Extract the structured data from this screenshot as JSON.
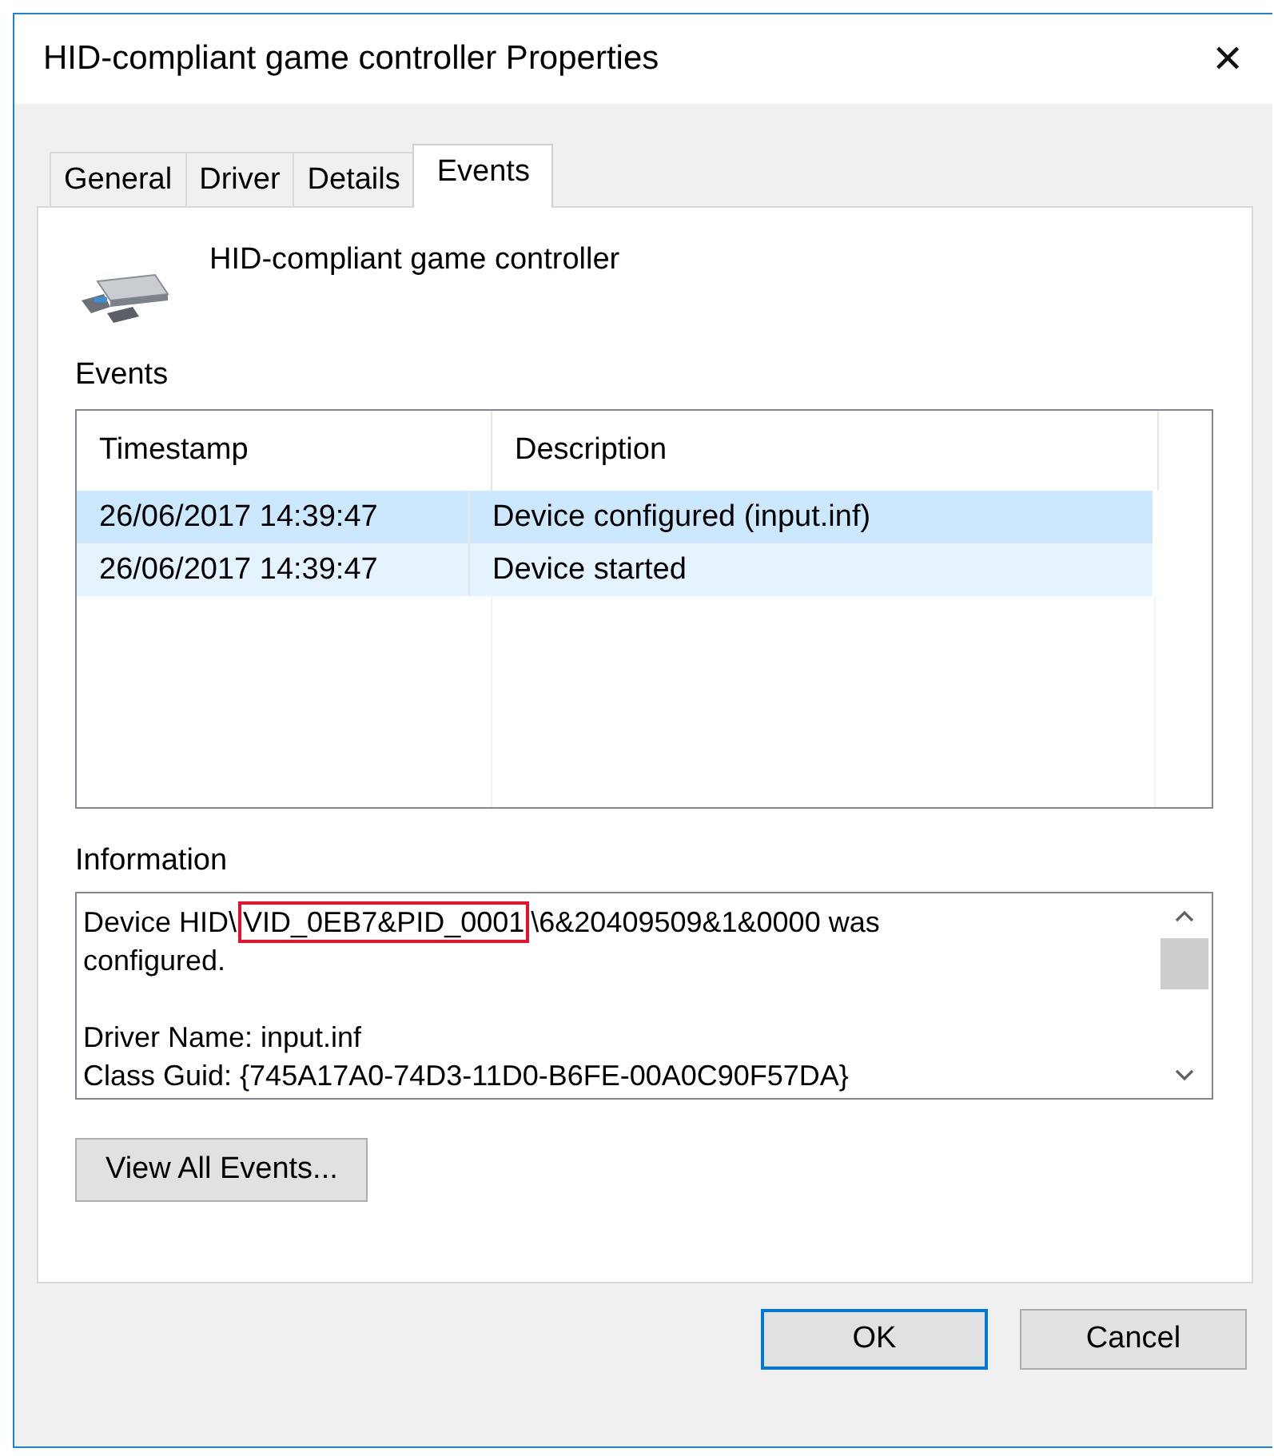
{
  "window": {
    "title": "HID-compliant game controller Properties",
    "close": "✕"
  },
  "tabs": [
    {
      "label": "General",
      "selected": false
    },
    {
      "label": "Driver",
      "selected": false
    },
    {
      "label": "Details",
      "selected": false
    },
    {
      "label": "Events",
      "selected": true
    }
  ],
  "device": {
    "name": "HID-compliant game controller"
  },
  "events": {
    "label": "Events",
    "columns": [
      "Timestamp",
      "Description"
    ],
    "rows": [
      {
        "timestamp": "26/06/2017 14:39:47",
        "description": "Device configured (input.inf)",
        "selected": true,
        "hovered": false
      },
      {
        "timestamp": "26/06/2017 14:39:47",
        "description": "Device started",
        "selected": false,
        "hovered": true
      }
    ]
  },
  "information": {
    "label": "Information",
    "paragraphs": [
      {
        "lines": [
          {
            "before": "Device HID\\",
            "marked": "VID_0EB7&PID_0001",
            "after": "\\6&20409509&1&0000 was configured."
          }
        ]
      },
      {
        "lines": [
          {
            "text": "Driver Name: input.inf"
          },
          {
            "text": "Class Guid: {745A17A0-74D3-11D0-B6FE-00A0C90F57DA}"
          }
        ]
      }
    ]
  },
  "view_all_button": "View All Events...",
  "buttons": [
    {
      "label": "OK",
      "kind": "default"
    },
    {
      "label": "Cancel",
      "kind": "normal"
    }
  ]
}
